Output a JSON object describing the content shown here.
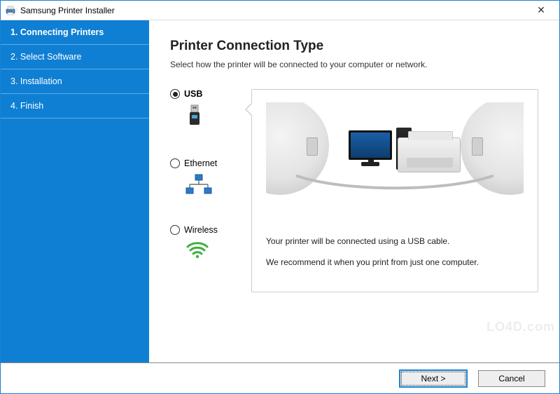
{
  "window": {
    "title": "Samsung Printer Installer",
    "close_glyph": "✕"
  },
  "sidebar": {
    "steps": [
      {
        "label": "1. Connecting Printers",
        "active": true
      },
      {
        "label": "2. Select Software",
        "active": false
      },
      {
        "label": "3. Installation",
        "active": false
      },
      {
        "label": "4. Finish",
        "active": false
      }
    ]
  },
  "main": {
    "heading": "Printer Connection Type",
    "subtitle": "Select how the printer will be connected to your computer or network.",
    "options": [
      {
        "key": "usb",
        "label": "USB",
        "selected": true
      },
      {
        "key": "ethernet",
        "label": "Ethernet",
        "selected": false
      },
      {
        "key": "wireless",
        "label": "Wireless",
        "selected": false
      }
    ],
    "preview": {
      "line1": "Your printer will be connected using a USB cable.",
      "line2": "We recommend it when you print from just one computer."
    }
  },
  "buttons": {
    "next": "Next >",
    "cancel": "Cancel"
  },
  "watermark": "LO4D.com"
}
